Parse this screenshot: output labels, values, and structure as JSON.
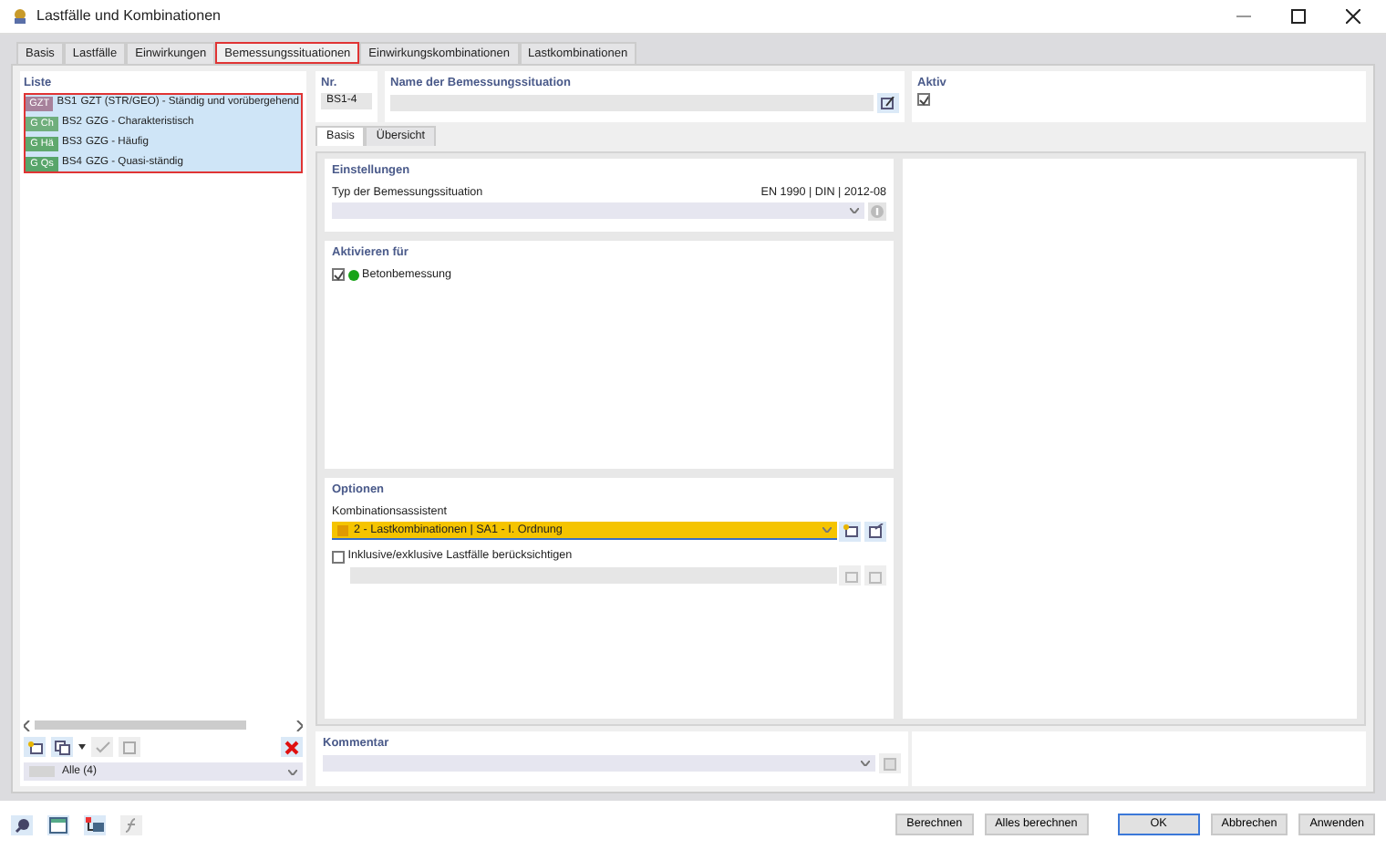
{
  "window": {
    "title": "Lastfälle und Kombinationen"
  },
  "tabs": [
    {
      "label": "Basis",
      "selected": false,
      "highlighted": false
    },
    {
      "label": "Lastfälle",
      "selected": false,
      "highlighted": false
    },
    {
      "label": "Einwirkungen",
      "selected": false,
      "highlighted": false
    },
    {
      "label": "Bemessungssituationen",
      "selected": true,
      "highlighted": true
    },
    {
      "label": "Einwirkungskombinationen",
      "selected": false,
      "highlighted": false
    },
    {
      "label": "Lastkombinationen",
      "selected": false,
      "highlighted": false
    }
  ],
  "liste": {
    "title": "Liste",
    "highlighted": true,
    "filter": "Alle (4)",
    "items": [
      {
        "tag": "GZT",
        "color": "#a7819b",
        "number": "BS1",
        "name": "GZT (STR/GEO) - Ständig und vorübergehend",
        "selected": true
      },
      {
        "tag": "G Ch",
        "color": "#6fae7c",
        "number": "BS2",
        "name": "GZG - Charakteristisch",
        "selected": true
      },
      {
        "tag": "G Hä",
        "color": "#5fa86d",
        "number": "BS3",
        "name": "GZG - Häufig",
        "selected": true
      },
      {
        "tag": "G Qs",
        "color": "#58a56a",
        "number": "BS4",
        "name": "GZG - Quasi-ständig",
        "selected": true
      }
    ]
  },
  "nr": {
    "label": "Nr.",
    "value": "BS1-4"
  },
  "name": {
    "label": "Name der Bemessungssituation"
  },
  "aktiv": {
    "label": "Aktiv",
    "checked": true
  },
  "inner_tabs": [
    {
      "label": "Basis",
      "selected": true
    },
    {
      "label": "Übersicht",
      "selected": false
    }
  ],
  "einstellungen": {
    "title": "Einstellungen",
    "type_label": "Typ der Bemessungssituation",
    "norm": "EN 1990 | DIN | 2012-08"
  },
  "aktivieren": {
    "title": "Aktivieren für",
    "items": [
      {
        "label": "Betonbemessung",
        "checked": true,
        "color": "#17a317"
      }
    ]
  },
  "optionen": {
    "title": "Optionen",
    "assistant_label": "Kombinationsassistent",
    "assistant_value": "2 - Lastkombinationen | SA1 - I. Ordnung",
    "inclusive_label": "Inklusive/exklusive Lastfälle berücksichtigen",
    "inclusive_checked": false
  },
  "kommentar": {
    "title": "Kommentar"
  },
  "buttons": [
    {
      "label": "Berechnen",
      "default": false
    },
    {
      "label": "Alles berechnen",
      "default": false
    },
    {
      "label": "OK",
      "default": true
    },
    {
      "label": "Abbrechen",
      "default": false
    },
    {
      "label": "Anwenden",
      "default": false
    }
  ]
}
